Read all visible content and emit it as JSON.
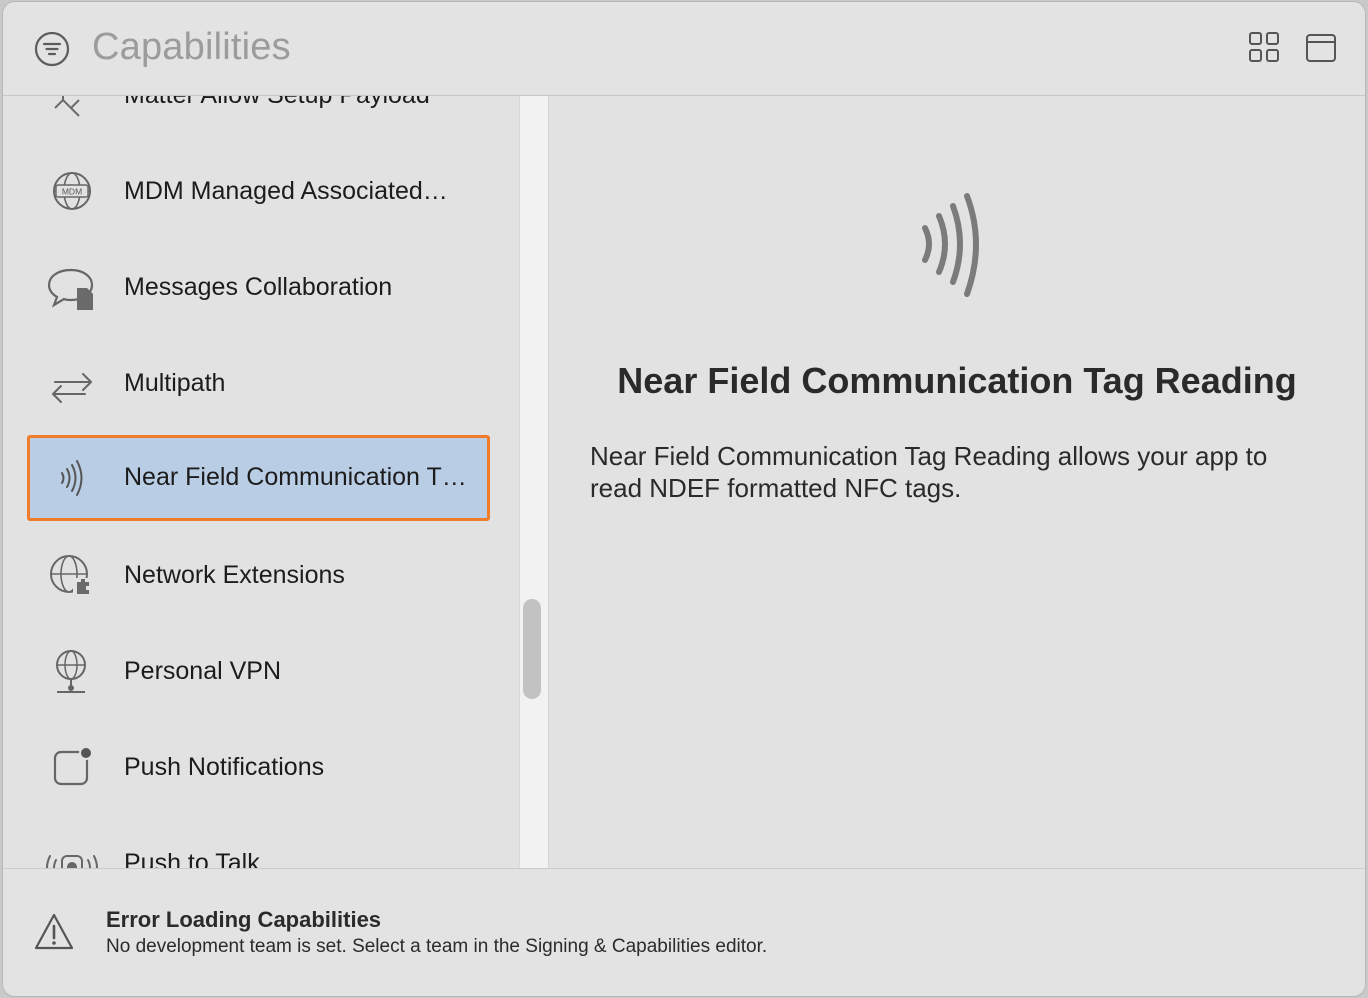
{
  "header": {
    "title": "Capabilities"
  },
  "sidebar": {
    "items": [
      {
        "label": "Matter Allow Setup Payload",
        "icon": "matter-icon"
      },
      {
        "label": "MDM Managed Associated…",
        "icon": "mdm-globe-icon"
      },
      {
        "label": "Messages Collaboration",
        "icon": "messages-collaboration-icon"
      },
      {
        "label": "Multipath",
        "icon": "multipath-arrows-icon"
      },
      {
        "label": "Near Field Communication T…",
        "icon": "nfc-icon",
        "selected": true
      },
      {
        "label": "Network Extensions",
        "icon": "network-extensions-icon"
      },
      {
        "label": "Personal VPN",
        "icon": "personal-vpn-icon"
      },
      {
        "label": "Push Notifications",
        "icon": "push-notifications-icon"
      },
      {
        "label": "Push to Talk",
        "icon": "push-to-talk-icon"
      }
    ]
  },
  "detail": {
    "title": "Near Field Communication Tag Reading",
    "description": "Near Field Communication Tag Reading allows your app to read NDEF formatted NFC tags.",
    "icon": "nfc-large-icon"
  },
  "footer": {
    "error_title": "Error Loading Capabilities",
    "error_message": "No development team is set. Select a team in the Signing & Capabilities editor.",
    "icon": "warning-triangle-icon"
  },
  "colors": {
    "selection_fill": "#b9cde4",
    "selection_border": "#f07b2b",
    "background": "#e2e2e2"
  }
}
